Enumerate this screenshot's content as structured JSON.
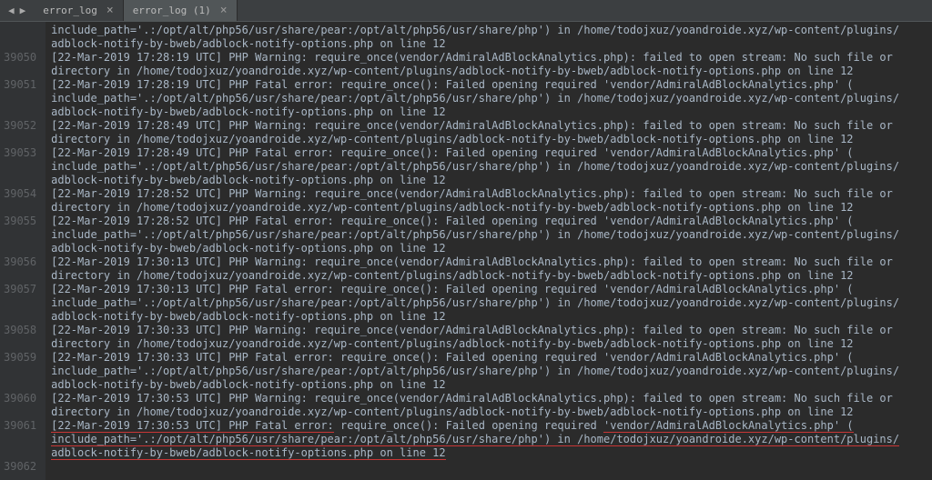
{
  "tabs": [
    {
      "label": "error_log"
    },
    {
      "label": "error_log (1)"
    }
  ],
  "lines": [
    {
      "num": "",
      "text": "include_path='.:/opt/alt/php56/usr/share/pear:/opt/alt/php56/usr/share/php') in /home/todojxuz/yoandroide.xyz/wp-content/plugins/",
      "hl": []
    },
    {
      "num": "",
      "text": "adblock-notify-by-bweb/adblock-notify-options.php on line 12",
      "hl": []
    },
    {
      "num": "39050",
      "text": "[22-Mar-2019 17:28:19 UTC] PHP Warning:  require_once(vendor/AdmiralAdBlockAnalytics.php): failed to open stream: No such file or",
      "hl": []
    },
    {
      "num": "",
      "text": "directory in /home/todojxuz/yoandroide.xyz/wp-content/plugins/adblock-notify-by-bweb/adblock-notify-options.php on line 12",
      "hl": []
    },
    {
      "num": "39051",
      "text": "[22-Mar-2019 17:28:19 UTC] PHP Fatal error:  require_once(): Failed opening required 'vendor/AdmiralAdBlockAnalytics.php' (",
      "hl": []
    },
    {
      "num": "",
      "text": "include_path='.:/opt/alt/php56/usr/share/pear:/opt/alt/php56/usr/share/php') in /home/todojxuz/yoandroide.xyz/wp-content/plugins/",
      "hl": []
    },
    {
      "num": "",
      "text": "adblock-notify-by-bweb/adblock-notify-options.php on line 12",
      "hl": []
    },
    {
      "num": "39052",
      "text": "[22-Mar-2019 17:28:49 UTC] PHP Warning:  require_once(vendor/AdmiralAdBlockAnalytics.php): failed to open stream: No such file or",
      "hl": []
    },
    {
      "num": "",
      "text": "directory in /home/todojxuz/yoandroide.xyz/wp-content/plugins/adblock-notify-by-bweb/adblock-notify-options.php on line 12",
      "hl": []
    },
    {
      "num": "39053",
      "text": "[22-Mar-2019 17:28:49 UTC] PHP Fatal error:  require_once(): Failed opening required 'vendor/AdmiralAdBlockAnalytics.php' (",
      "hl": []
    },
    {
      "num": "",
      "text": "include_path='.:/opt/alt/php56/usr/share/pear:/opt/alt/php56/usr/share/php') in /home/todojxuz/yoandroide.xyz/wp-content/plugins/",
      "hl": []
    },
    {
      "num": "",
      "text": "adblock-notify-by-bweb/adblock-notify-options.php on line 12",
      "hl": []
    },
    {
      "num": "39054",
      "text": "[22-Mar-2019 17:28:52 UTC] PHP Warning:  require_once(vendor/AdmiralAdBlockAnalytics.php): failed to open stream: No such file or",
      "hl": []
    },
    {
      "num": "",
      "text": "directory in /home/todojxuz/yoandroide.xyz/wp-content/plugins/adblock-notify-by-bweb/adblock-notify-options.php on line 12",
      "hl": []
    },
    {
      "num": "39055",
      "text": "[22-Mar-2019 17:28:52 UTC] PHP Fatal error:  require_once(): Failed opening required 'vendor/AdmiralAdBlockAnalytics.php' (",
      "hl": []
    },
    {
      "num": "",
      "text": "include_path='.:/opt/alt/php56/usr/share/pear:/opt/alt/php56/usr/share/php') in /home/todojxuz/yoandroide.xyz/wp-content/plugins/",
      "hl": []
    },
    {
      "num": "",
      "text": "adblock-notify-by-bweb/adblock-notify-options.php on line 12",
      "hl": []
    },
    {
      "num": "39056",
      "text": "[22-Mar-2019 17:30:13 UTC] PHP Warning:  require_once(vendor/AdmiralAdBlockAnalytics.php): failed to open stream: No such file or",
      "hl": []
    },
    {
      "num": "",
      "text": "directory in /home/todojxuz/yoandroide.xyz/wp-content/plugins/adblock-notify-by-bweb/adblock-notify-options.php on line 12",
      "hl": []
    },
    {
      "num": "39057",
      "text": "[22-Mar-2019 17:30:13 UTC] PHP Fatal error:  require_once(): Failed opening required 'vendor/AdmiralAdBlockAnalytics.php' (",
      "hl": []
    },
    {
      "num": "",
      "text": "include_path='.:/opt/alt/php56/usr/share/pear:/opt/alt/php56/usr/share/php') in /home/todojxuz/yoandroide.xyz/wp-content/plugins/",
      "hl": []
    },
    {
      "num": "",
      "text": "adblock-notify-by-bweb/adblock-notify-options.php on line 12",
      "hl": []
    },
    {
      "num": "39058",
      "text": "[22-Mar-2019 17:30:33 UTC] PHP Warning:  require_once(vendor/AdmiralAdBlockAnalytics.php): failed to open stream: No such file or",
      "hl": []
    },
    {
      "num": "",
      "text": "directory in /home/todojxuz/yoandroide.xyz/wp-content/plugins/adblock-notify-by-bweb/adblock-notify-options.php on line 12",
      "hl": []
    },
    {
      "num": "39059",
      "text": "[22-Mar-2019 17:30:33 UTC] PHP Fatal error:  require_once(): Failed opening required 'vendor/AdmiralAdBlockAnalytics.php' (",
      "hl": []
    },
    {
      "num": "",
      "text": "include_path='.:/opt/alt/php56/usr/share/pear:/opt/alt/php56/usr/share/php') in /home/todojxuz/yoandroide.xyz/wp-content/plugins/",
      "hl": []
    },
    {
      "num": "",
      "text": "adblock-notify-by-bweb/adblock-notify-options.php on line 12",
      "hl": []
    },
    {
      "num": "39060",
      "text": "[22-Mar-2019 17:30:53 UTC] PHP Warning:  require_once(vendor/AdmiralAdBlockAnalytics.php): failed to open stream: No such file or",
      "hl": []
    },
    {
      "num": "",
      "text": "directory in /home/todojxuz/yoandroide.xyz/wp-content/plugins/adblock-notify-by-bweb/adblock-notify-options.php on line 12",
      "hl": []
    },
    {
      "num": "39061",
      "text": "",
      "hl": [
        {
          "t": "[22-Mar-2019 17:30:53 UTC] PHP Fatal error:",
          "u": true
        },
        {
          "t": "  require_once(): Failed opening required ",
          "u": false
        },
        {
          "t": "'vendor/AdmiralAdBlockAnalytics.php' (",
          "u": true
        }
      ]
    },
    {
      "num": "",
      "text": "",
      "hl": [
        {
          "t": "include_path='.:/opt/alt/php56/usr/share/pear:/opt/alt/php56/usr/share/php') in /home/todojxuz/yoandroide.xyz/wp-content/plugins/",
          "u": true
        }
      ]
    },
    {
      "num": "",
      "text": "",
      "hl": [
        {
          "t": "adblock-notify-by-bweb/adblock-notify-options.php on line 12",
          "u": true
        }
      ]
    },
    {
      "num": "39062",
      "text": "",
      "hl": []
    }
  ]
}
